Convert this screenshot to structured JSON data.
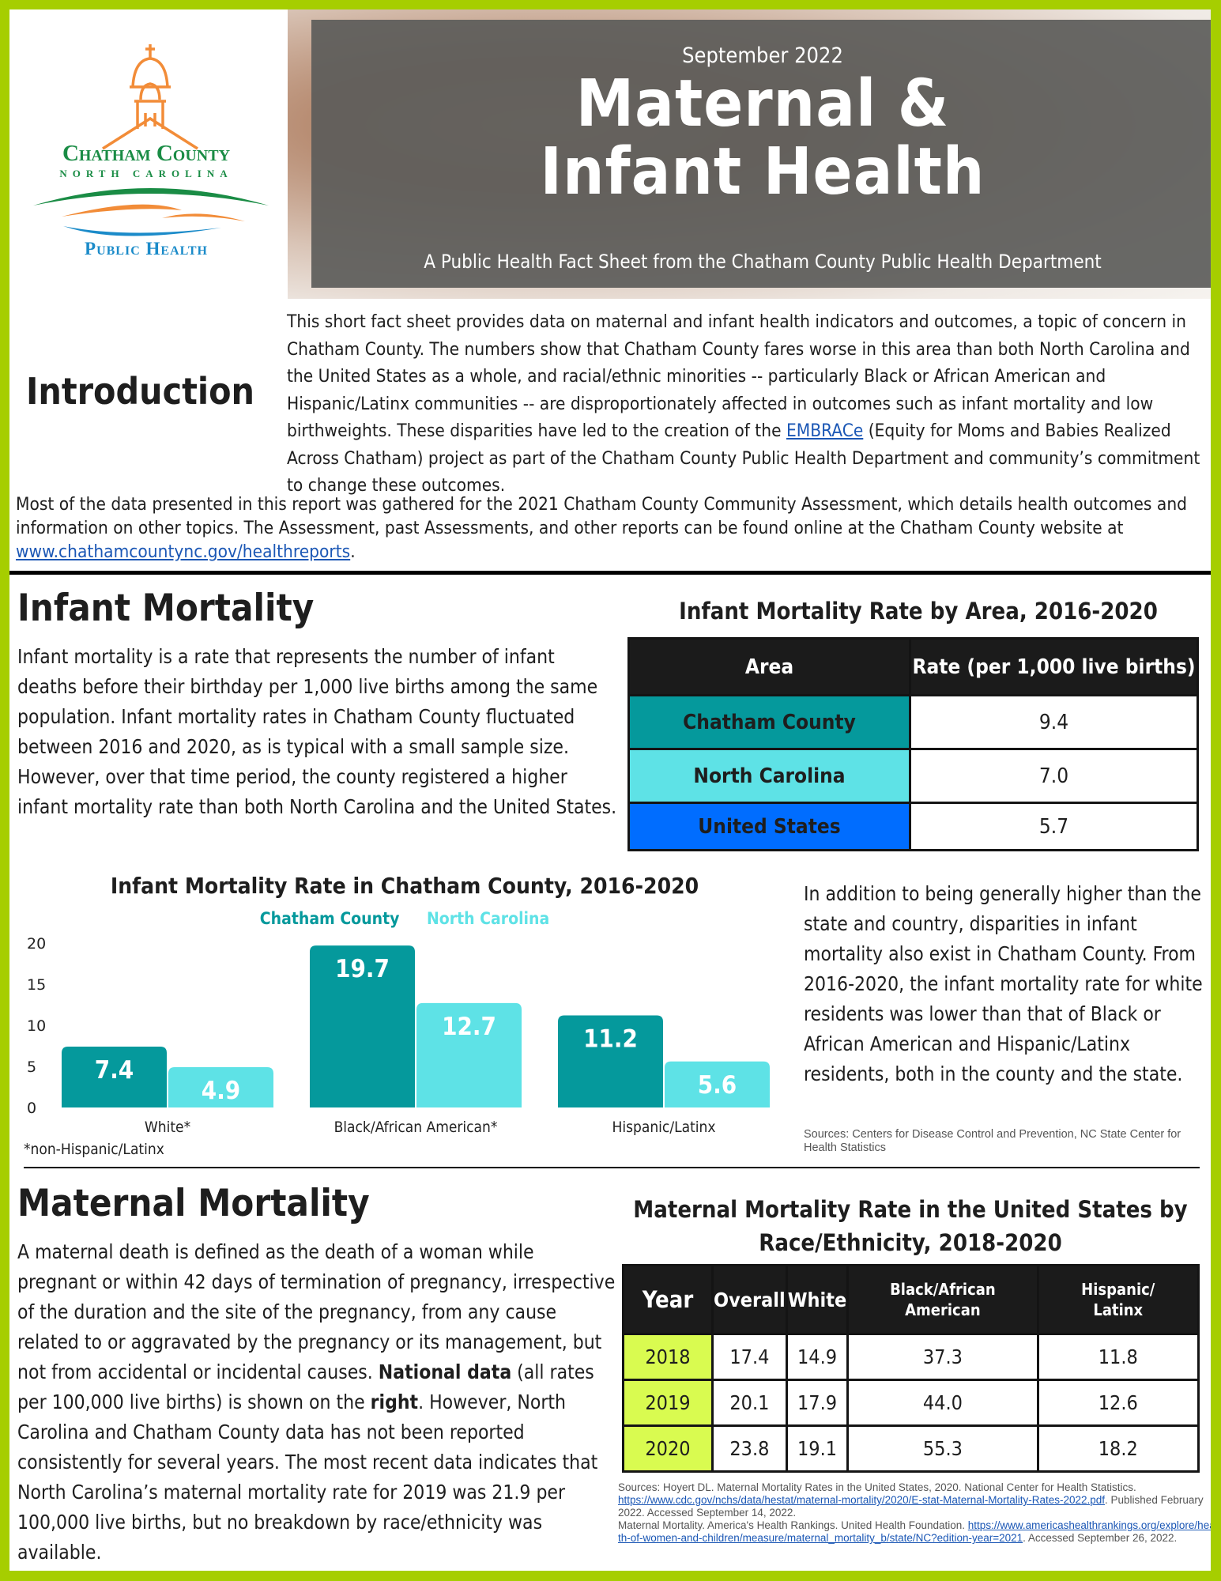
{
  "logo": {
    "name_line1": "Chatham County",
    "name_line2": "NORTH CAROLINA",
    "name_line3": "Public Health",
    "colors": {
      "green": "#1a8c45",
      "orange": "#f28c38",
      "blue": "#1b8bc9"
    }
  },
  "header": {
    "date": "September 2022",
    "title_line1": "Maternal &",
    "title_line2": "Infant Health",
    "subtitle": "A Public Health Fact Sheet from the Chatham County Public Health Department"
  },
  "intro": {
    "heading": "Introduction",
    "p1_before_link": "This short fact sheet provides data on maternal and infant health indicators and outcomes, a topic of concern in Chatham County. The numbers show that Chatham County fares worse in this area than both North Carolina and the United States as a whole, and racial/ethnic minorities -- particularly Black or African American and Hispanic/Latinx communities -- are disproportionately affected in outcomes such as infant mortality and low birthweights. These disparities have led to the creation of the ",
    "p1_link": "EMBRACe",
    "p1_after_link": " (Equity for Moms and Babies Realized Across Chatham) project as part of the Chatham County Public Health Department and community’s commitment to change these outcomes.",
    "p2_before_link": "Most of the data presented in this report was gathered for the 2021 Chatham County Community Assessment, which details health outcomes and information on other topics. The Assessment, past Assessments, and other reports can be found online at the Chatham County website at ",
    "p2_link": "www.chathamcountync.gov/healthreports",
    "p2_after_link": "."
  },
  "infant": {
    "heading": "Infant Mortality",
    "paragraph": "Infant mortality is a rate that represents the number of infant deaths before their birthday per 1,000 live births among the same population. Infant mortality rates in Chatham County fluctuated between 2016 and 2020, as is typical with a small sample size. However, over that time period, the county registered a higher infant mortality rate than both North Carolina and the United States.",
    "area_table": {
      "title": "Infant Mortality Rate by Area, 2016-2020",
      "headers": [
        "Area",
        "Rate (per 1,000 live births)"
      ],
      "rows": [
        {
          "area": "Chatham County",
          "rate": "9.4",
          "color": "#05999c"
        },
        {
          "area": "North Carolina",
          "rate": "7.0",
          "color": "#5ee2e6"
        },
        {
          "area": "United States",
          "rate": "5.7",
          "color": "#006dff"
        }
      ]
    },
    "disparities_paragraph": "In addition to being generally higher than the state and country, disparities in infant mortality also exist in Chatham County. From 2016-2020, the infant mortality rate for white residents was lower than that of Black or African American and Hispanic/Latinx residents, both in the county and the state.",
    "sources": "Sources: Centers for Disease Control and Prevention, NC State Center for Health Statistics",
    "footnote": "*non-Hispanic/Latinx"
  },
  "chart_data": {
    "type": "bar",
    "title": "Infant Mortality Rate in Chatham County, 2016-2020",
    "categories": [
      "White*",
      "Black/African American*",
      "Hispanic/Latinx"
    ],
    "series": [
      {
        "name": "Chatham County",
        "values": [
          7.4,
          19.7,
          11.2
        ],
        "color": "#05999c"
      },
      {
        "name": "North Carolina",
        "values": [
          4.9,
          12.7,
          5.6
        ],
        "color": "#5ee2e6"
      }
    ],
    "xlabel": "",
    "ylabel": "",
    "ylim": [
      0,
      20
    ],
    "yticks": [
      0,
      5,
      10,
      15,
      20
    ],
    "legend": "top-center",
    "grid": false,
    "data_labels": true
  },
  "maternal": {
    "heading": "Maternal Mortality",
    "p_part1": "A maternal death is defined as the death of a woman while pregnant or within 42 days of termination of pregnancy, irrespective of the duration and the site of the pregnancy, from any cause related to or aggravated by the pregnancy or its management, but not from accidental or incidental causes. ",
    "p_bold1": "National data",
    "p_part2": " (all rates per 100,000 live births) is shown on the ",
    "p_bold2": "right",
    "p_part3": ". However, North Carolina and Chatham County data has not been reported consistently for several years. The most recent data indicates that North Carolina’s maternal mortality rate for 2019 was 21.9 per 100,000 live births, but no breakdown by race/ethnicity was available.",
    "table": {
      "title": "Maternal Mortality Rate in the United States by Race/Ethnicity, 2018-2020",
      "headers": [
        "Year",
        "Overall",
        "White",
        "Black/African American",
        "Hispanic/ Latinx"
      ],
      "rows": [
        [
          "2018",
          "17.4",
          "14.9",
          "37.3",
          "11.8"
        ],
        [
          "2019",
          "20.1",
          "17.9",
          "44.0",
          "12.6"
        ],
        [
          "2020",
          "23.8",
          "19.1",
          "55.3",
          "18.2"
        ]
      ]
    },
    "sources": {
      "s1_text": "Sources: Hoyert DL. Maternal Mortality Rates in the United States, 2020. National Center for Health Statistics. ",
      "s1_link": "https://www.cdc.gov/nchs/data/hestat/maternal-mortality/2020/E-stat-Maternal-Mortality-Rates-2022.pdf",
      "s1_after": ". Published February 2022. Accessed September 14, 2022.",
      "s2_text": "Maternal Mortality. America's Health Rankings. United Health Foundation. ",
      "s2_link": "https://www.americashealthrankings.org/explore/health-of-women-and-children/measure/maternal_mortality_b/state/NC?edition-year=2021",
      "s2_after": ". Accessed September 26, 2022."
    }
  },
  "colors": {
    "border_green": "#a6ce00",
    "teal": "#05999c",
    "light_teal": "#5ee2e6",
    "blue": "#006dff",
    "year_lime": "#d9fb50",
    "header_gray": "#5c5c5a"
  }
}
